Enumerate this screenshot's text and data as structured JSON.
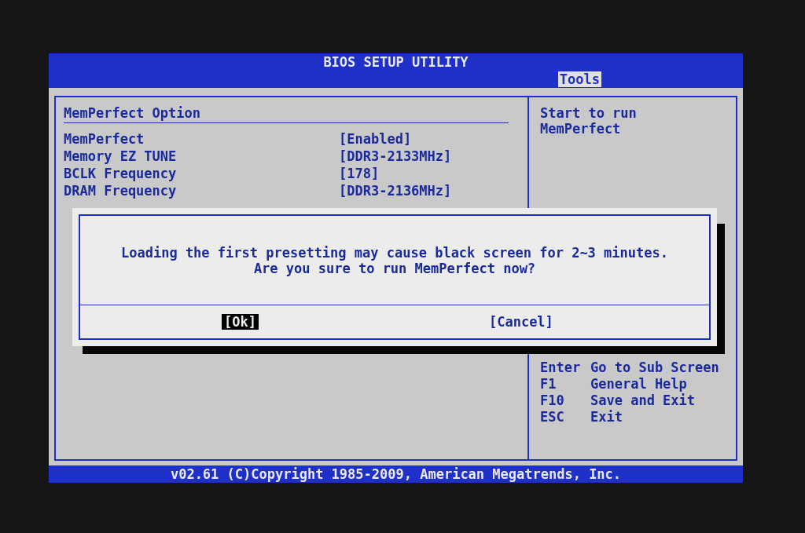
{
  "title": "BIOS SETUP UTILITY",
  "tabs": [
    {
      "label": "Tools",
      "selected": true
    }
  ],
  "section_title": "MemPerfect Option",
  "options": [
    {
      "label": "MemPerfect",
      "value": "[Enabled]"
    },
    {
      "label": "Memory EZ TUNE",
      "value": "[DDR3-2133MHz]"
    },
    {
      "label": "BCLK Frequency",
      "value": "[178]"
    },
    {
      "label": "DRAM Frequency",
      "value": "[DDR3-2136MHz]"
    }
  ],
  "help_lines": [
    "Start to run",
    "MemPerfect"
  ],
  "keys": [
    {
      "key": "Enter",
      "action": "Go to Sub Screen"
    },
    {
      "key": "F1",
      "action": "General Help"
    },
    {
      "key": "F10",
      "action": "Save and Exit"
    },
    {
      "key": "ESC",
      "action": "Exit"
    }
  ],
  "dialog": {
    "message_lines": [
      "Loading the first presetting may cause black screen for 2~3 minutes.",
      "Are you sure to run MemPerfect now?"
    ],
    "buttons": [
      {
        "label": "[Ok]",
        "selected": true
      },
      {
        "label": "[Cancel]",
        "selected": false
      }
    ]
  },
  "footer": "v02.61 (C)Copyright 1985-2009, American Megatrends, Inc."
}
